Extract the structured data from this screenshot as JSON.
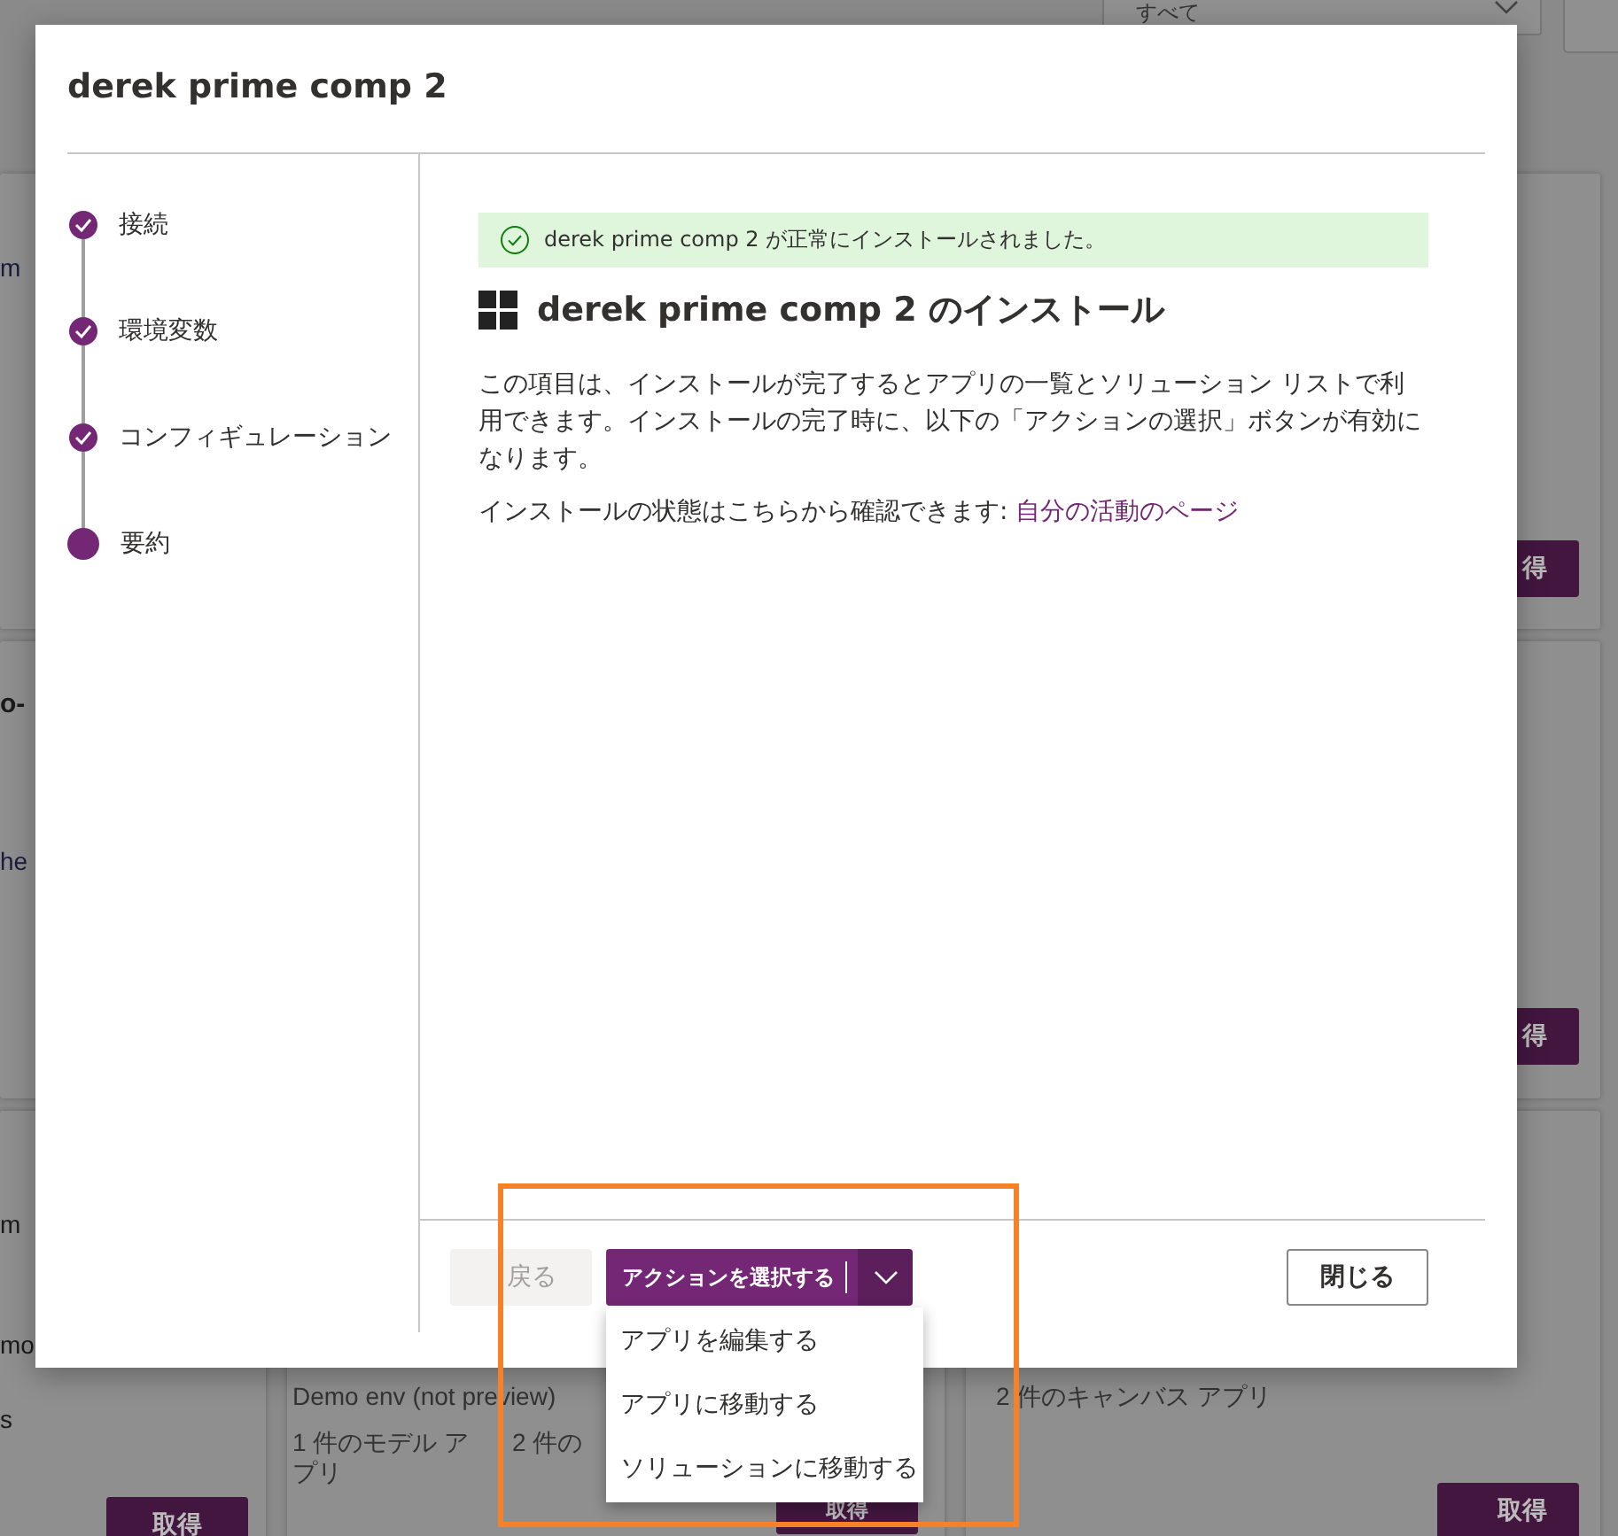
{
  "background_page": {
    "filter_dropdown": {
      "value": "すべて"
    },
    "left_cards": [
      {
        "lines": [
          {
            "text": "m",
            "kind": "link"
          }
        ]
      },
      {
        "lines": [
          {
            "text": "o-",
            "kind": "bold"
          },
          {
            "text": "he",
            "kind": "link"
          }
        ]
      },
      {
        "lines": [
          {
            "text": "m",
            "kind": "plain"
          },
          {
            "text": "mo",
            "kind": "plain"
          },
          {
            "text": "s",
            "kind": "plain"
          }
        ],
        "button": "取得"
      }
    ],
    "middle_card": {
      "lines": [
        {
          "text": "Demo env (not preview)",
          "kind": "plain"
        }
      ],
      "counts": [
        "1 件のモデル アプリ",
        "2 件の"
      ],
      "button": "取得"
    },
    "right_cards": [
      {
        "button": "得"
      },
      {
        "button": "得"
      },
      {
        "counts": [
          "2 件のキャンバス アプリ"
        ],
        "button": "取得"
      }
    ]
  },
  "dialog": {
    "title": "derek prime comp 2",
    "steps": [
      {
        "label": "接続",
        "completed": true
      },
      {
        "label": "環境変数",
        "completed": true
      },
      {
        "label": "コンフィギュレーション",
        "completed": true
      },
      {
        "label": "要約",
        "completed": false
      }
    ],
    "banner": {
      "kind": "success",
      "text": "derek prime comp 2 が正常にインストールされました。"
    },
    "heading": "derek prime comp 2 のインストール",
    "description": "この項目は、インストールが完了するとアプリの一覧とソリューション リストで利用できます。インストールの完了時に、以下の「アクションの選択」ボタンが有効になります。",
    "status_line": {
      "text": "インストールの状態はこちらから確認できます:",
      "link": "自分の活動のページ"
    },
    "back_button": {
      "label": "戻る",
      "disabled": true
    },
    "action_button": {
      "label": "アクションを選択する",
      "expanded": true,
      "menu": [
        {
          "label": "アプリを編集する"
        },
        {
          "label": "アプリに移動する"
        },
        {
          "label": "ソリューションに移動する"
        }
      ]
    },
    "close_button": {
      "label": "閉じる"
    }
  },
  "annotation_frame": true
}
